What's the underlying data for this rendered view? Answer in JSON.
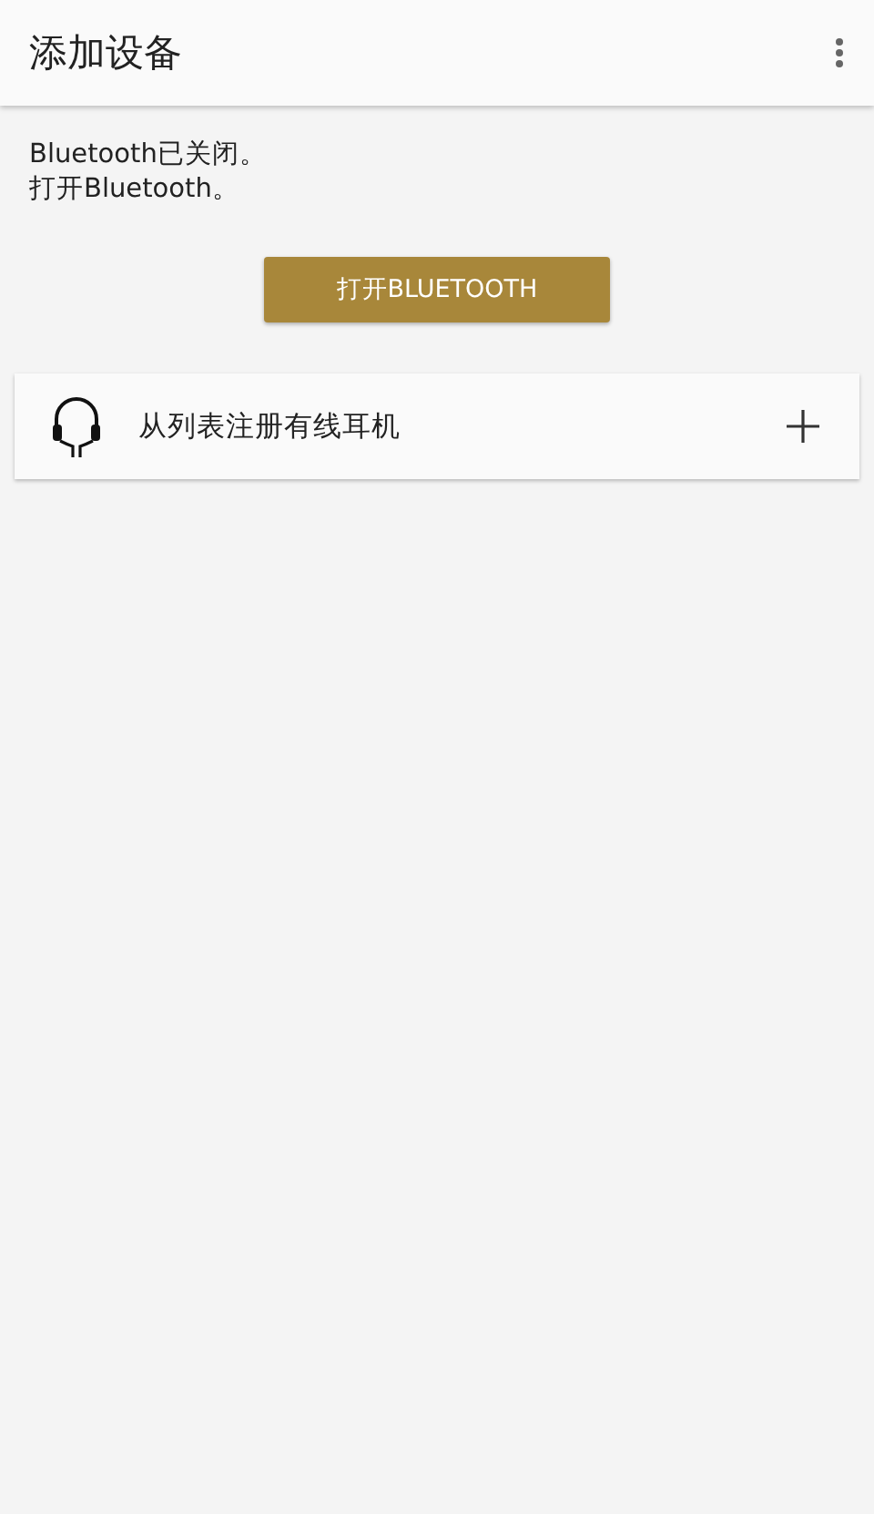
{
  "app_bar": {
    "title": "添加设备"
  },
  "message": {
    "lines": [
      "Bluetooth已关闭。",
      "打开Bluetooth。"
    ]
  },
  "enable_button": {
    "label": "打开BLUETOOTH"
  },
  "list": [
    {
      "kind": "headphones",
      "label": "从列表注册有线耳机"
    }
  ]
}
